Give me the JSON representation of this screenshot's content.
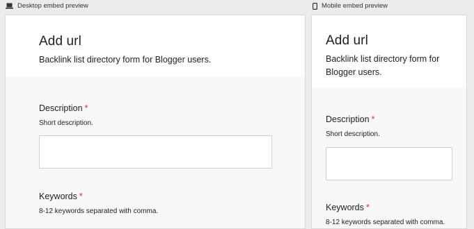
{
  "desktop_preview": {
    "label": "Desktop embed preview",
    "icon": "laptop-icon"
  },
  "mobile_preview": {
    "label": "Mobile embed preview",
    "icon": "phone-icon"
  },
  "form": {
    "title": "Add url",
    "description": "Backlink list directory form for Blogger users.",
    "required_mark": "*",
    "fields": [
      {
        "label": "Description",
        "hint": "Short description.",
        "value": ""
      },
      {
        "label": "Keywords",
        "hint": "8-12 keywords separated with comma."
      }
    ]
  },
  "colors": {
    "required": "#d93025",
    "background": "#ececec",
    "form_body": "#f8f8f8"
  }
}
